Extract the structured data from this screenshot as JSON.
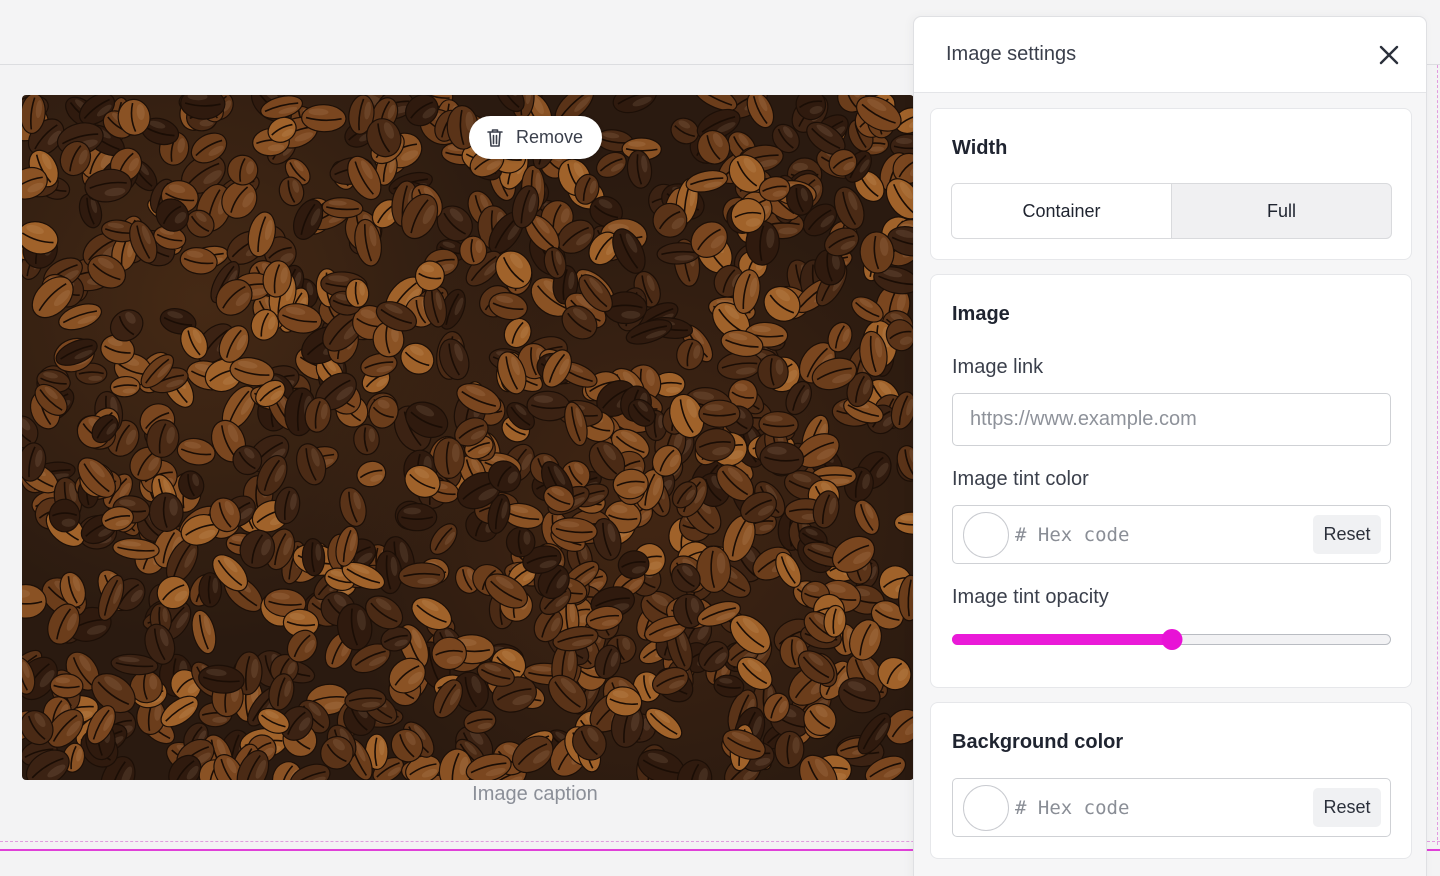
{
  "image_block": {
    "remove_label": "Remove",
    "caption": "Image caption"
  },
  "panel": {
    "title": "Image settings",
    "width_section": {
      "title": "Width",
      "options": [
        "Container",
        "Full"
      ],
      "selected": "Container"
    },
    "image_section": {
      "title": "Image",
      "link_label": "Image link",
      "link_value": "",
      "link_placeholder": "https://www.example.com",
      "tint_color_label": "Image tint color",
      "tint_color_placeholder": "# Hex code",
      "tint_color_value": "",
      "reset_label": "Reset",
      "tint_opacity_label": "Image tint opacity",
      "tint_opacity_value": 0.5
    },
    "background_section": {
      "title": "Background color",
      "color_placeholder": "# Hex code",
      "color_value": "",
      "reset_label": "Reset"
    }
  },
  "colors": {
    "accent": "#e812d6",
    "section_outline": "#e040d8"
  },
  "icons": {
    "remove": "trash-icon",
    "close": "close-icon"
  }
}
